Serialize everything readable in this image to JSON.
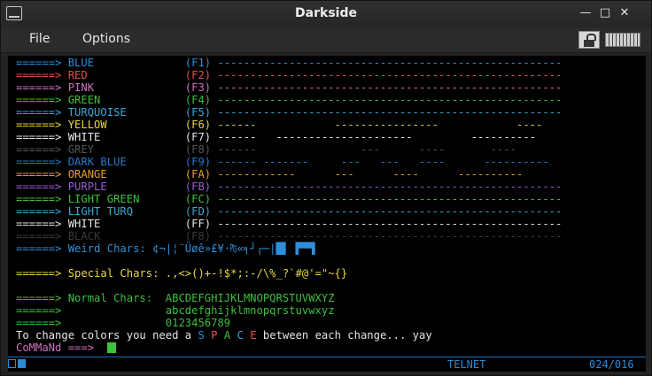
{
  "window": {
    "title": "Darkside"
  },
  "menu": {
    "file": "File",
    "options": "Options"
  },
  "terminal": {
    "lines": [
      {
        "segments": [
          {
            "t": "======> ",
            "c": "#2f8fd8"
          },
          {
            "t": "BLUE",
            "c": "#2f8fd8"
          },
          {
            "t": "              ",
            "c": "#2f8fd8"
          },
          {
            "t": "(F1) ",
            "c": "#2f8fd8"
          },
          {
            "t": "-----------------------------------------------------",
            "c": "#2f8fd8"
          }
        ]
      },
      {
        "segments": [
          {
            "t": "======> ",
            "c": "#e05050"
          },
          {
            "t": "RED",
            "c": "#e05050"
          },
          {
            "t": "               ",
            "c": "#e05050"
          },
          {
            "t": "(F2) ",
            "c": "#e05050"
          },
          {
            "t": "-----------------------------------------------------",
            "c": "#e05050"
          }
        ]
      },
      {
        "segments": [
          {
            "t": "======> ",
            "c": "#d070c0"
          },
          {
            "t": "PINK",
            "c": "#d070c0"
          },
          {
            "t": "              ",
            "c": "#d070c0"
          },
          {
            "t": "(F3) ",
            "c": "#d070c0"
          },
          {
            "t": "-----------------------------------------------------",
            "c": "#d070c0"
          }
        ]
      },
      {
        "segments": [
          {
            "t": "======> ",
            "c": "#3cc03c"
          },
          {
            "t": "GREEN",
            "c": "#3cc03c"
          },
          {
            "t": "             ",
            "c": "#3cc03c"
          },
          {
            "t": "(F4) ",
            "c": "#3cc03c"
          },
          {
            "t": "-----------------------------------------------------",
            "c": "#3cc03c"
          }
        ]
      },
      {
        "segments": [
          {
            "t": "======> ",
            "c": "#38a8d8"
          },
          {
            "t": "TURQUOISE",
            "c": "#38a8d8"
          },
          {
            "t": "         ",
            "c": "#38a8d8"
          },
          {
            "t": "(F5) ",
            "c": "#38a8d8"
          },
          {
            "t": "-----------------------------------------------------",
            "c": "#38a8d8"
          }
        ]
      },
      {
        "segments": [
          {
            "t": "======> ",
            "c": "#e8d840"
          },
          {
            "t": "YELLOW",
            "c": "#e8d840"
          },
          {
            "t": "            ",
            "c": "#e8d840"
          },
          {
            "t": "(F6) ",
            "c": "#e8d840"
          },
          {
            "t": "------            ----------------            ----",
            "c": "#e8d840"
          }
        ]
      },
      {
        "segments": [
          {
            "t": "======> ",
            "c": "#e6e6e6"
          },
          {
            "t": "WHITE",
            "c": "#e6e6e6"
          },
          {
            "t": "             ",
            "c": "#e6e6e6"
          },
          {
            "t": "(F7) ",
            "c": "#e6e6e6"
          },
          {
            "t": "------   ---------------------         ----------",
            "c": "#e6e6e6"
          }
        ]
      },
      {
        "segments": [
          {
            "t": "======> ",
            "c": "#555555"
          },
          {
            "t": "GREY",
            "c": "#555555"
          },
          {
            "t": "              ",
            "c": "#555555"
          },
          {
            "t": "(F8) ",
            "c": "#555555"
          },
          {
            "t": "------                ---      ----       ----",
            "c": "#555555"
          }
        ]
      },
      {
        "segments": [
          {
            "t": "======> ",
            "c": "#2a78c8"
          },
          {
            "t": "DARK BLUE",
            "c": "#2a78c8"
          },
          {
            "t": "         ",
            "c": "#2a78c8"
          },
          {
            "t": "(F9) ",
            "c": "#2a78c8"
          },
          {
            "t": "------ -------     ---   ---   ----      ----------",
            "c": "#2a78c8"
          }
        ]
      },
      {
        "segments": [
          {
            "t": "======> ",
            "c": "#e8a020"
          },
          {
            "t": "ORANGE",
            "c": "#e8a020"
          },
          {
            "t": "            ",
            "c": "#e8a020"
          },
          {
            "t": "(FA) ",
            "c": "#e8a020"
          },
          {
            "t": "------------      ---      ----      ----------",
            "c": "#e8a020"
          }
        ]
      },
      {
        "segments": [
          {
            "t": "======> ",
            "c": "#9a5ad8"
          },
          {
            "t": "PURPLE",
            "c": "#9a5ad8"
          },
          {
            "t": "            ",
            "c": "#9a5ad8"
          },
          {
            "t": "(FB) ",
            "c": "#9a5ad8"
          },
          {
            "t": "-----------------------------------------------------",
            "c": "#9a5ad8"
          }
        ]
      },
      {
        "segments": [
          {
            "t": "======> ",
            "c": "#3cc03c"
          },
          {
            "t": "LIGHT GREEN",
            "c": "#3cc03c"
          },
          {
            "t": "       ",
            "c": "#3cc03c"
          },
          {
            "t": "(FC) ",
            "c": "#3cc03c"
          },
          {
            "t": "-----------------------------------------------------",
            "c": "#3cc03c"
          }
        ]
      },
      {
        "segments": [
          {
            "t": "======> ",
            "c": "#38a8d8"
          },
          {
            "t": "LIGHT TURQ",
            "c": "#38a8d8"
          },
          {
            "t": "        ",
            "c": "#38a8d8"
          },
          {
            "t": "(FD) ",
            "c": "#38a8d8"
          },
          {
            "t": "-----------------------------------------------------",
            "c": "#38a8d8"
          }
        ]
      },
      {
        "segments": [
          {
            "t": "======> ",
            "c": "#e6e6e6"
          },
          {
            "t": "WHITE",
            "c": "#e6e6e6"
          },
          {
            "t": "             ",
            "c": "#e6e6e6"
          },
          {
            "t": "(FF) ",
            "c": "#e6e6e6"
          },
          {
            "t": "-----------------------------------------------------",
            "c": "#e6e6e6"
          }
        ]
      },
      {
        "segments": [
          {
            "t": "======> ",
            "c": "#3a3a3a"
          },
          {
            "t": "BLACK",
            "c": "#3a3a3a"
          },
          {
            "t": "             ",
            "c": "#3a3a3a"
          },
          {
            "t": "(F8) ",
            "c": "#3a3a3a"
          },
          {
            "t": "-----------------------------------------------------",
            "c": "#3a3a3a"
          }
        ]
      },
      {
        "segments": [
          {
            "t": "======> ",
            "c": "#2f8fd8"
          },
          {
            "t": "Weird Chars: ",
            "c": "#2f8fd8"
          },
          {
            "t": "¢¬|¦¨Üøê»£¥·₧«╕┘┌─|█▌ ▛▀▜",
            "c": "#2f8fd8"
          }
        ]
      },
      {
        "segments": [
          {
            "t": "",
            "c": "#000"
          }
        ]
      },
      {
        "segments": [
          {
            "t": "======> ",
            "c": "#e8d840"
          },
          {
            "t": "Special Chars: ",
            "c": "#e8d840"
          },
          {
            "t": ".,<>()+-!$*;:-/\\%_?`#@'=\"~{}",
            "c": "#e8d840"
          }
        ]
      },
      {
        "segments": [
          {
            "t": "",
            "c": "#000"
          }
        ]
      },
      {
        "segments": [
          {
            "t": "======> ",
            "c": "#3cc03c"
          },
          {
            "t": "Normal Chars:  ",
            "c": "#3cc03c"
          },
          {
            "t": "ABCDEFGHIJKLMNOPQRSTUVWXYZ",
            "c": "#3cc03c"
          }
        ]
      },
      {
        "segments": [
          {
            "t": "======> ",
            "c": "#3cc03c"
          },
          {
            "t": "               ",
            "c": "#3cc03c"
          },
          {
            "t": "abcdefghijklmnopqrstuvwxyz",
            "c": "#3cc03c"
          }
        ]
      },
      {
        "segments": [
          {
            "t": "======> ",
            "c": "#3cc03c"
          },
          {
            "t": "               ",
            "c": "#3cc03c"
          },
          {
            "t": "0123456789",
            "c": "#3cc03c"
          }
        ]
      },
      {
        "segments": [
          {
            "t": "To change colors you need a ",
            "c": "#e6e6e6"
          },
          {
            "t": "S ",
            "c": "#2f8fd8"
          },
          {
            "t": "P ",
            "c": "#e05050"
          },
          {
            "t": "A ",
            "c": "#3cc03c"
          },
          {
            "t": "C ",
            "c": "#38a8d8"
          },
          {
            "t": "E ",
            "c": "#e05050"
          },
          {
            "t": "between each change... yay",
            "c": "#e6e6e6"
          }
        ]
      },
      {
        "segments": [
          {
            "t": "CoMMaNd ===> ",
            "c": "#d070c0"
          },
          {
            "t": " ",
            "c": "#3cc03c"
          }
        ]
      }
    ]
  },
  "status": {
    "protocol": "TELNET",
    "position": "024/016"
  },
  "colors": {
    "status_accent": "#2a8ad6",
    "terminal_bg": "#000000"
  }
}
